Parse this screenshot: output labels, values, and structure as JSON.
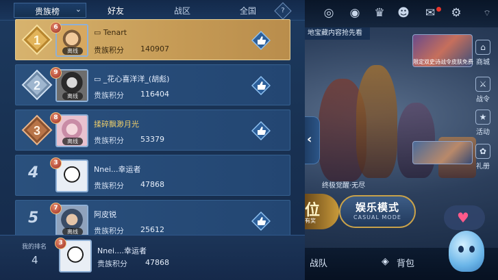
{
  "colors": {
    "accent": "#6fb3ff",
    "gold_row": "#d7b36e",
    "vip_badge": "#9b2b23",
    "panel": "#1d3a5f"
  },
  "tabs": {
    "board_select": "贵族榜",
    "items": [
      {
        "label": "好友",
        "active": true
      },
      {
        "label": "战区",
        "active": false
      },
      {
        "label": "全国",
        "active": false
      }
    ],
    "help_symbol": "?"
  },
  "leaderboard": {
    "score_label": "贵族积分",
    "status_text": "离线",
    "rows": [
      {
        "rank": "1",
        "name": "Tenart",
        "vip_level": "6",
        "score": "140907",
        "show_status": true,
        "show_like": true
      },
      {
        "rank": "2",
        "name": "_花心喜洋洋_(胡彪)",
        "vip_level": "9",
        "score": "116404",
        "show_status": true,
        "show_like": true
      },
      {
        "rank": "3",
        "name": "揉碎飘渺月光",
        "vip_level": "8",
        "score": "53379",
        "show_status": true,
        "show_like": true
      },
      {
        "rank": "4",
        "name": "Nnei...幸运者",
        "vip_level": "3",
        "score": "47868",
        "show_status": false,
        "show_like": false
      },
      {
        "rank": "5",
        "name": "阿皮锐",
        "vip_level": "7",
        "score": "25612",
        "show_status": true,
        "show_like": true
      }
    ]
  },
  "my_rank": {
    "label": "我的排名",
    "rank": "4",
    "name": "Nnei....幸运者",
    "vip_level": "3",
    "score_label": "贵族积分",
    "score": "47868"
  },
  "background": {
    "notice": "地宝藏内容抢先看",
    "event_banner": "限定双史诗战令皮肤免费",
    "side_buttons": [
      {
        "label": "商城",
        "icon": "shop-icon"
      },
      {
        "label": "战令",
        "icon": "pass-icon"
      },
      {
        "label": "活动",
        "icon": "activity-icon"
      },
      {
        "label": "礼册",
        "icon": "gift-icon"
      }
    ],
    "subtitle": "终极觉醒·无尽",
    "mode_rank_text": "位",
    "mode_rank_sub": "有奖",
    "mode_casual_title": "娱乐模式",
    "mode_casual_sub": "CASUAL MODE",
    "bottom_team": "战队",
    "bottom_bag": "背包"
  }
}
